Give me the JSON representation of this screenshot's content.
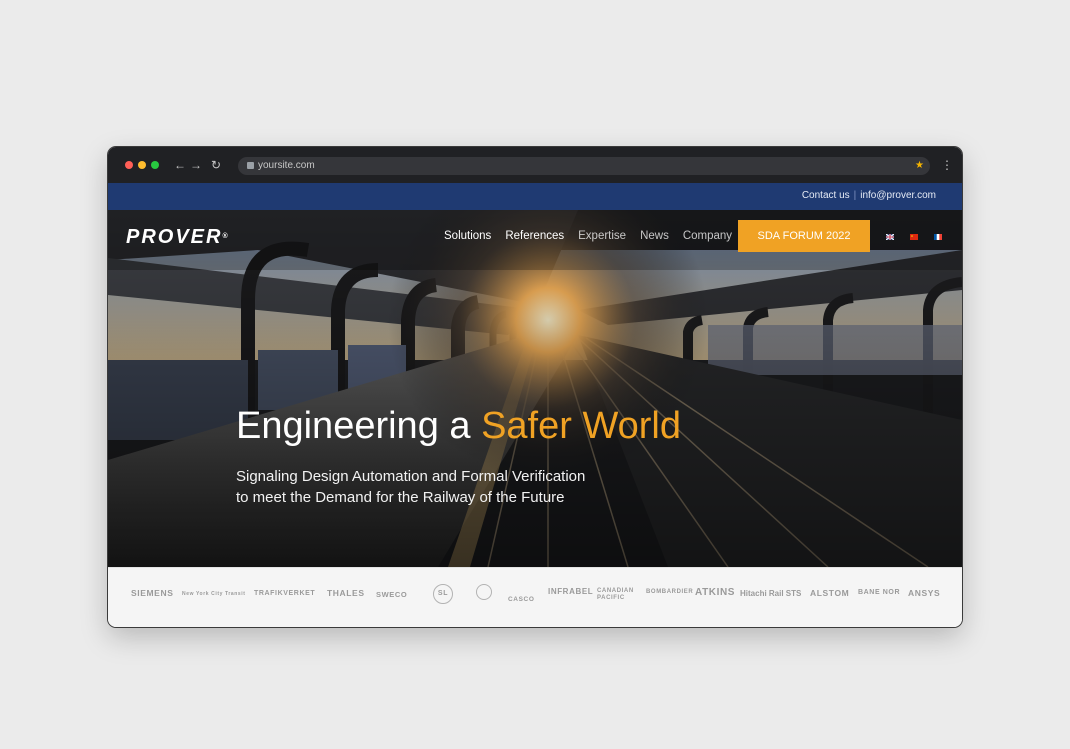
{
  "browser": {
    "url": "yoursite.com",
    "dots": [
      "#ff5f57",
      "#febc2e",
      "#28c840"
    ],
    "star_icon": "star-icon"
  },
  "topbar": {
    "contact_label": "Contact us",
    "email": "info@prover.com"
  },
  "header": {
    "logo_text": "PROVER",
    "logo_mark": "®",
    "nav": [
      {
        "label": "Solutions"
      },
      {
        "label": "References"
      },
      {
        "label": "Expertise"
      },
      {
        "label": "News"
      },
      {
        "label": "Company"
      }
    ],
    "cta_label": "SDA FORUM 2022",
    "languages": [
      "uk-flag",
      "china-flag",
      "france-flag"
    ]
  },
  "hero": {
    "title_plain": "Engineering a ",
    "title_accent": "Safer World",
    "subtitle_line1": "Signaling Design Automation and Formal Verification",
    "subtitle_line2": "to meet the Demand for the Railway of the Future"
  },
  "clients": [
    "SIEMENS",
    "New York City Transit",
    "TRAFIKVERKET",
    "THALES",
    "SWECO",
    "SL",
    "",
    "CASCO",
    "INFRABEL",
    "CANADIAN PACIFIC",
    "BOMBARDIER",
    "ATKINS",
    "Hitachi Rail STS",
    "ALSTOM",
    "BANE NOR",
    "ANSYS"
  ],
  "colors": {
    "accent": "#f0a224",
    "navy": "#1f3a72"
  }
}
